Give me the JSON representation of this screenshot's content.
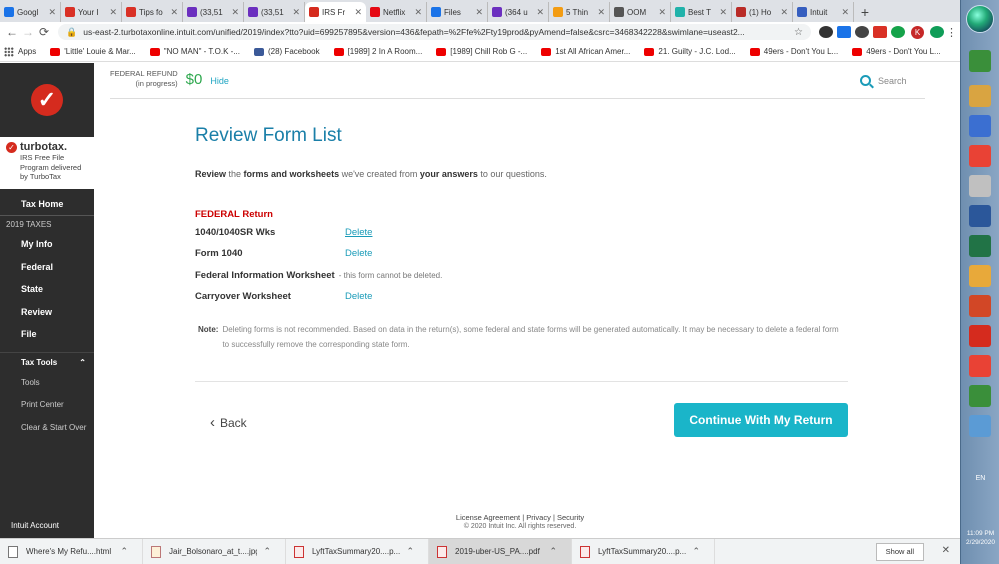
{
  "browser": {
    "tabs": [
      {
        "title": "Googl",
        "color": "#1a73e8"
      },
      {
        "title": "Your I",
        "color": "#d93025"
      },
      {
        "title": "Tips fo",
        "color": "#d93025"
      },
      {
        "title": "(33,51",
        "color": "#6b2fbf"
      },
      {
        "title": "(33,51",
        "color": "#6b2fbf"
      },
      {
        "title": "IRS Fr",
        "color": "#d52b1e",
        "active": true
      },
      {
        "title": "Netflix",
        "color": "#e50914"
      },
      {
        "title": "Files",
        "color": "#1a73e8"
      },
      {
        "title": "(364 u",
        "color": "#6b2fbf"
      },
      {
        "title": "5 Thin",
        "color": "#f39c12"
      },
      {
        "title": "OOM",
        "color": "#555555"
      },
      {
        "title": "Best T",
        "color": "#20b2aa"
      },
      {
        "title": "(1) Ho",
        "color": "#b92b27"
      },
      {
        "title": "Intuit",
        "color": "#365ebf"
      }
    ],
    "new_tab": "+",
    "url": "us-east-2.turbotaxonline.intuit.com/unified/2019/index?tto?uid=699257895&version=436&fepath=%2Ffe%2Fty19prod&pyAmend=false&csrc=3468342228&swimlane=useast2...",
    "profile_initial": "K",
    "bookmarks": [
      {
        "label": "Apps",
        "icon": "apps"
      },
      {
        "label": "'Little' Louie & Mar...",
        "icon": "yt"
      },
      {
        "label": "\"NO MAN\" - T.O.K -...",
        "icon": "yt"
      },
      {
        "label": "(28) Facebook",
        "icon": "fb"
      },
      {
        "label": "[1989] 2 In A Room...",
        "icon": "yt"
      },
      {
        "label": "[1989] Chill Rob G -...",
        "icon": "yt"
      },
      {
        "label": "1st All African Amer...",
        "icon": "yt"
      },
      {
        "label": "21. Guilty - J.C. Lod...",
        "icon": "yt"
      },
      {
        "label": "49ers - Don't You L...",
        "icon": "yt"
      },
      {
        "label": "49ers - Don't You L...",
        "icon": "yt"
      }
    ]
  },
  "sidebar": {
    "brand_name": "turbotax.",
    "brand_sub": [
      "IRS Free File",
      "Program delivered",
      "by TurboTax"
    ],
    "tax_home": "Tax Home",
    "section_label": "2019 TAXES",
    "items": [
      "My Info",
      "Federal",
      "State",
      "Review",
      "File"
    ],
    "tax_tools_label": "Tax Tools",
    "tools": [
      "Tools",
      "Print Center",
      "Clear & Start Over"
    ],
    "account_label": "Intuit Account"
  },
  "header": {
    "refund_label_1": "FEDERAL REFUND",
    "refund_label_2": "(in progress)",
    "refund_amount": "$0",
    "hide_label": "Hide",
    "search_label": "Search"
  },
  "main": {
    "title": "Review Form List",
    "intro_pre": "Review",
    "intro_mid1": " the ",
    "intro_bold1": "forms and worksheets",
    "intro_mid2": " we've created from ",
    "intro_bold2": "your answers",
    "intro_post": " to our questions.",
    "section_title": "FEDERAL Return",
    "forms": [
      {
        "name": "1040/1040SR Wks",
        "action": "Delete"
      },
      {
        "name": "Form 1040",
        "action": "Delete"
      },
      {
        "name": "Federal Information Worksheet",
        "note": "- this form cannot be deleted."
      },
      {
        "name": "Carryover Worksheet",
        "action": "Delete"
      }
    ],
    "note_label": "Note:",
    "note_text": "Deleting forms is not recommended. Based on data in the return(s), some federal and state forms will be generated automatically. It may be necessary to delete a federal form to successfully remove the corresponding state form.",
    "back_label": "Back",
    "continue_label": "Continue With My Return"
  },
  "footer": {
    "links": [
      "License Agreement",
      "Privacy",
      "Security"
    ],
    "copyright": "© 2020 Intuit Inc. All rights reserved."
  },
  "downloads": {
    "items": [
      {
        "name": "Where's My Refu....html",
        "type": "doc"
      },
      {
        "name": "Jair_Bolsonaro_at_t....jpg",
        "type": "img"
      },
      {
        "name": "LyftTaxSummary20....p...",
        "type": "pdf"
      },
      {
        "name": "2019-uber-US_PA....pdf",
        "type": "pdf",
        "selected": true
      },
      {
        "name": "LyftTaxSummary20....p...",
        "type": "pdf"
      }
    ],
    "show_all": "Show all"
  },
  "taskbar": {
    "language": "EN",
    "time": "11:09 PM",
    "date": "2/29/2020",
    "icons": [
      "#3a8f3a",
      "#d9a441",
      "#3b6fd1",
      "#e94235",
      "#c0c0c0",
      "#2b579a",
      "#217346",
      "#e8a93a",
      "#d24726",
      "#d52b1e",
      "#e94235",
      "#3a8f3a",
      "#5b9bd5"
    ]
  }
}
